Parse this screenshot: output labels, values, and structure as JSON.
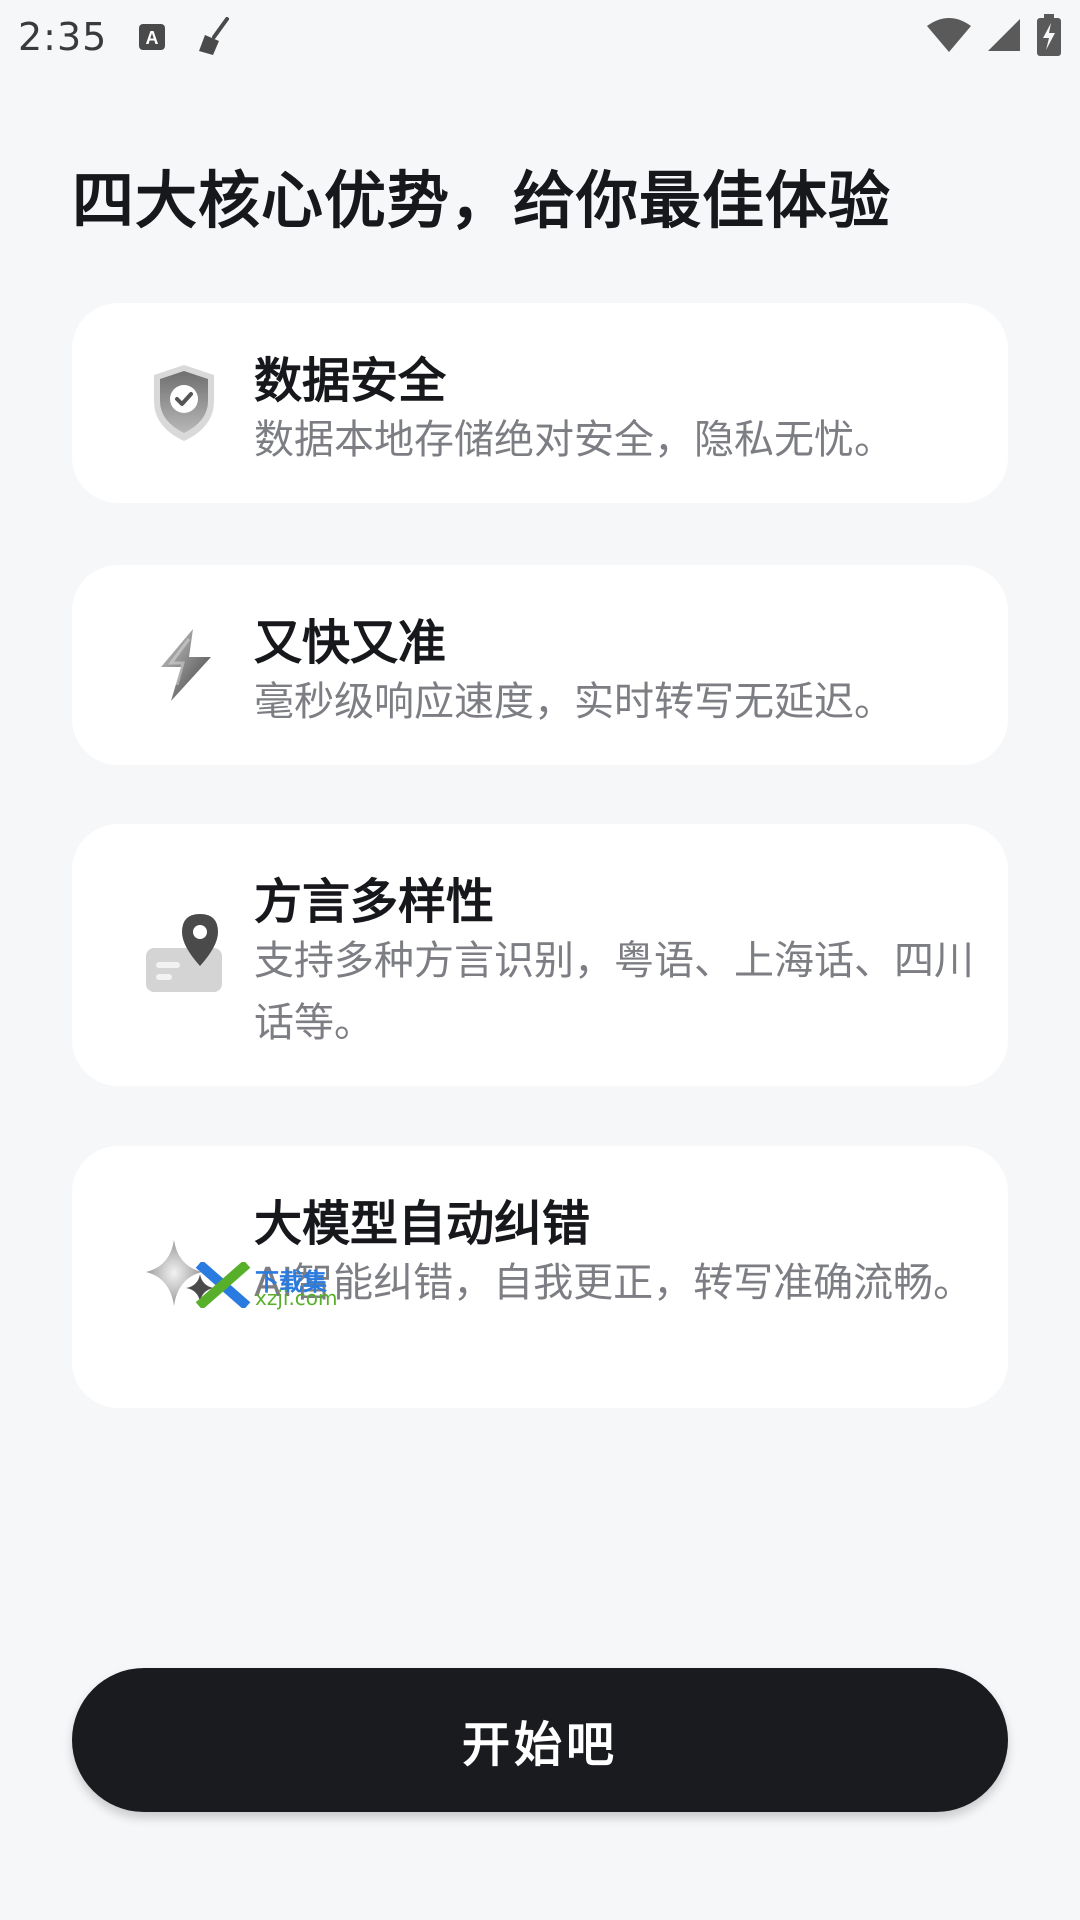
{
  "status_bar": {
    "time": "2:35",
    "left_icons": [
      "text-a-icon",
      "broom-icon"
    ],
    "right_icons": [
      "wifi-icon",
      "signal-icon",
      "battery-charging-icon"
    ]
  },
  "headline": "四大核心优势，给你最佳体验",
  "features": [
    {
      "icon": "shield-check-icon",
      "title": "数据安全",
      "description": "数据本地存储绝对安全，隐私无忧。"
    },
    {
      "icon": "lightning-icon",
      "title": "又快又准",
      "description": "毫秒级响应速度，实时转写无延迟。"
    },
    {
      "icon": "map-pin-icon",
      "title": "方言多样性",
      "description": "支持多种方言识别，粤语、上海话、四川话等。"
    },
    {
      "icon": "sparkle-icon",
      "title": "大模型自动纠错",
      "description": "AI智能纠错，自我更正，转写准确流畅。"
    }
  ],
  "watermark": {
    "line1": "下载集",
    "line2": "xzji.com"
  },
  "start_button": {
    "label": "开始吧"
  },
  "colors": {
    "background": "#f6f7f9",
    "card": "#ffffff",
    "button": "#1a1b1f",
    "description": "#7c7e83"
  }
}
